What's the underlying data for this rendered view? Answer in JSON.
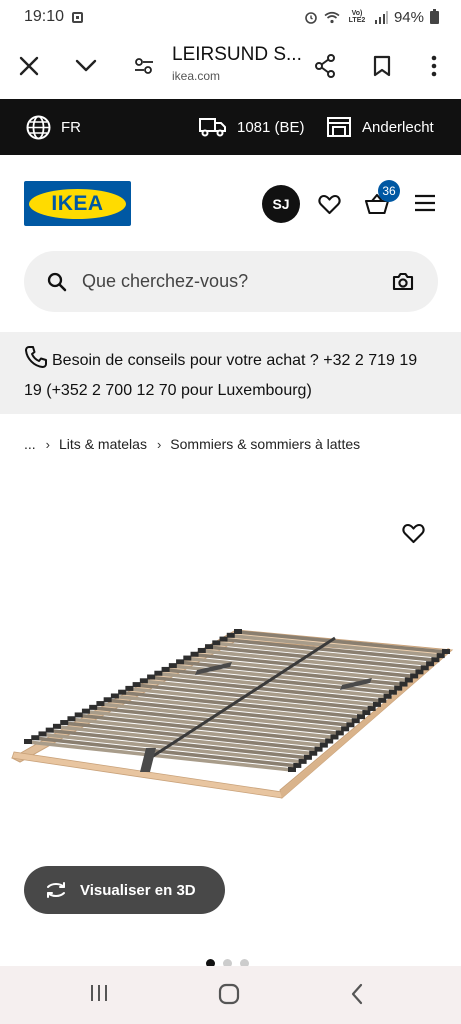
{
  "status_bar": {
    "time": "19:10",
    "network": "Vo) LTE2",
    "battery": "94%"
  },
  "browser": {
    "page_title": "LEIRSUND S...",
    "domain": "ikea.com",
    "icons": [
      "close-icon",
      "chevron-down-icon",
      "tune-icon",
      "share-icon",
      "bookmark-icon",
      "more-vert-icon"
    ]
  },
  "topbar": {
    "language": "FR",
    "postcode": "1081 (BE)",
    "store": "Anderlecht"
  },
  "header": {
    "logo_text": "IKEA",
    "avatar_initials": "SJ",
    "cart_count": "36",
    "colors": {
      "brand_blue": "#0058a3",
      "brand_yellow": "#ffdb00"
    }
  },
  "search": {
    "placeholder": "Que cherchez-vous?"
  },
  "contact": {
    "text": "Besoin de conseils pour votre achat ? +32 2 719 19 19 (+352 2 700 12 70 pour Luxembourg)"
  },
  "breadcrumb": {
    "items": [
      "...",
      "Lits & matelas",
      "Sommiers & sommiers à lattes"
    ]
  },
  "product": {
    "view_3d_label": "Visualiser en 3D",
    "carousel_dots": 3,
    "carousel_active_index": 0
  },
  "navbar": {
    "icons": [
      "recent-apps-icon",
      "home-icon",
      "back-icon"
    ]
  }
}
